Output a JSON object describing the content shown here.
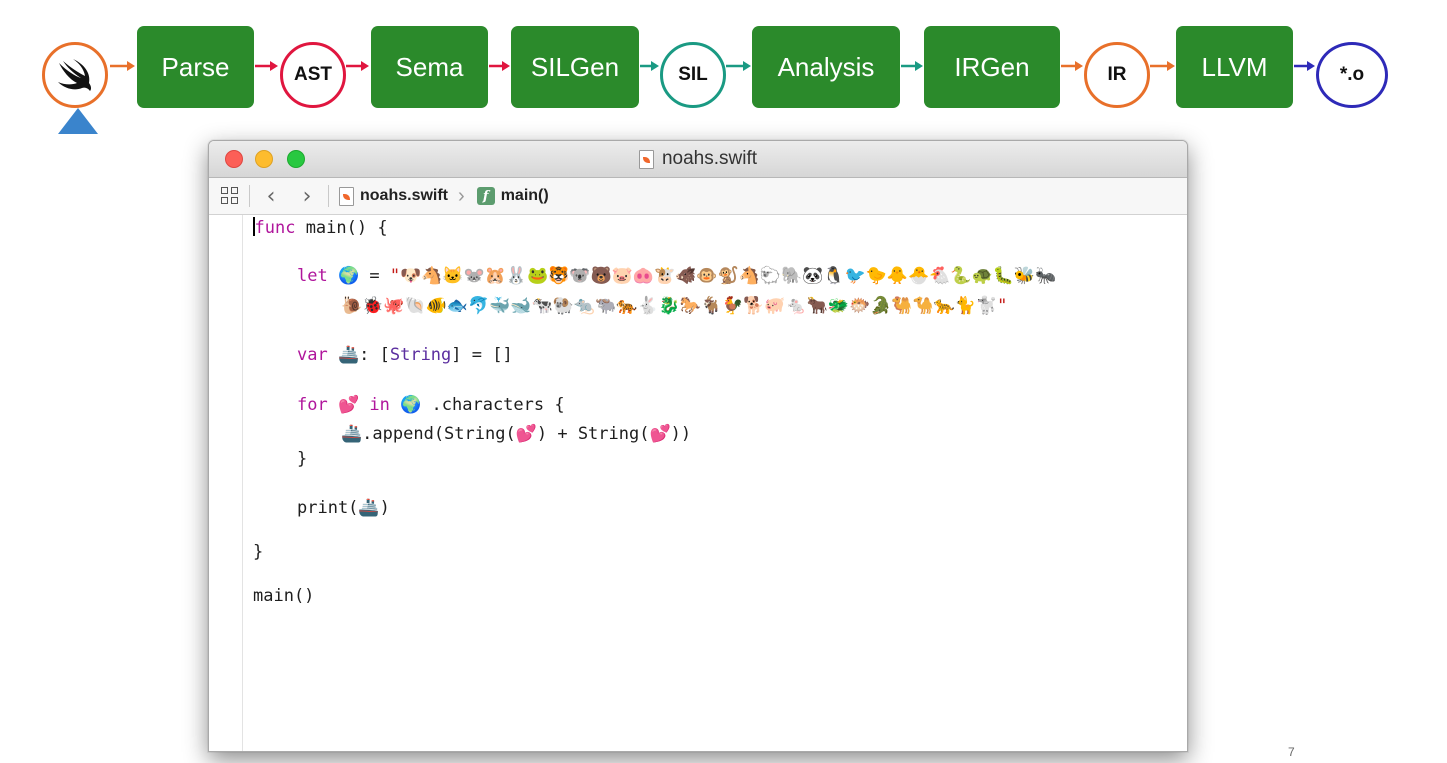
{
  "pipeline": {
    "logo": "swift-logo-icon",
    "stages": [
      "Parse",
      "AST",
      "Sema",
      "SILGen",
      "SIL",
      "Analysis",
      "IRGen",
      "IR",
      "LLVM",
      "*.o"
    ],
    "colors": {
      "box": "#2b8a2b",
      "swift": "#e8702a",
      "ast": "#e0163f",
      "sil": "#1a9a83",
      "ir": "#e8702a",
      "obj": "#2e2ab8",
      "pointer": "#3a84cc"
    }
  },
  "window": {
    "title": "noahs.swift",
    "breadcrumb_file": "noahs.swift",
    "breadcrumb_symbol": "main()"
  },
  "code": {
    "line1_kw": "func",
    "line1_rest": " main() {",
    "line2_kw": "let",
    "line2_var": "🌍",
    "line2_eq": " = ",
    "line2_str_open": "\"🐶🐴🐱🐭🐹🐰🐸🐯🐨🐻🐷🐽🐮🐗🐵🐒🐴🐑🐘🐼🐧🐦🐤🐥🐣🐔🐍🐢🐛🐝🐜",
    "line3_str": "🐌🐞🐙🐚🐠🐟🐬🐳🐋🐄🐏🐀🐃🐅🐇🐉🐎🐐🐓🐕🐖🐁🐂🐲🐡🐊🐫🐪🐆🐈🐩\"",
    "line4_kw": "var",
    "line4_var": "🚢",
    "line4_mid": ": [",
    "line4_type": "String",
    "line4_end": "] = []",
    "line5_kw1": "for",
    "line5_var": "💕",
    "line5_kw2": "in",
    "line5_world": "🌍",
    "line5_rest": " .characters {",
    "line6_ship": "🚢",
    "line6_rest1": ".append(String(",
    "line6_love1": "💕",
    "line6_rest2": ") + String(",
    "line6_love2": "💕",
    "line6_rest3": "))",
    "line7": "}",
    "line8_pre": "print(",
    "line8_ship": "🚢",
    "line8_post": ")",
    "line9": "}",
    "line10": "main()"
  },
  "page_number": "7"
}
